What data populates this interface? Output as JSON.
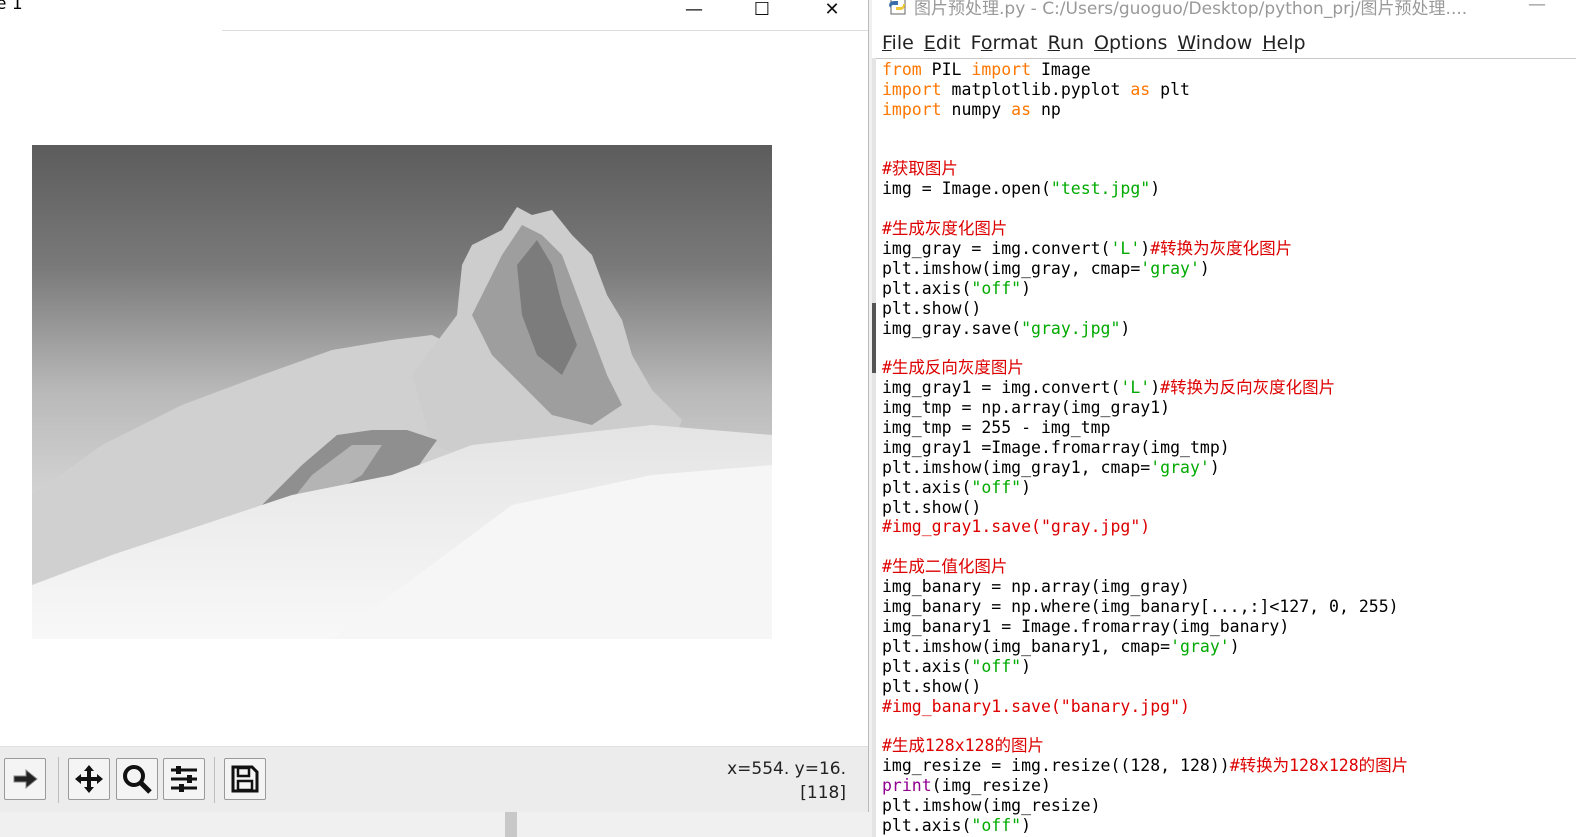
{
  "figure_window": {
    "title": "e 1",
    "controls": {
      "minimize": "—",
      "maximize": "☐",
      "close": "✕"
    },
    "toolbar": {
      "buttons": [
        "forward-icon",
        "pan-icon",
        "zoom-icon",
        "configure-subplots-icon",
        "save-icon"
      ]
    },
    "coordinates": "x=554. y=16.",
    "pixel_value": "[118]"
  },
  "idle": {
    "title": "图片预处理.py - C:/Users/guoguo/Desktop/python_prj/图片预处理....",
    "minimize": "—",
    "menu": [
      {
        "pre": "",
        "u": "F",
        "post": "ile"
      },
      {
        "pre": "",
        "u": "E",
        "post": "dit"
      },
      {
        "pre": "F",
        "u": "o",
        "post": "rmat"
      },
      {
        "pre": "",
        "u": "R",
        "post": "un"
      },
      {
        "pre": "",
        "u": "O",
        "post": "ptions"
      },
      {
        "pre": "",
        "u": "W",
        "post": "indow"
      },
      {
        "pre": "",
        "u": "H",
        "post": "elp"
      }
    ],
    "code_lines": [
      [
        [
          "kw",
          "from"
        ],
        [
          "n",
          " PIL "
        ],
        [
          "kw",
          "import"
        ],
        [
          "n",
          " Image"
        ]
      ],
      [
        [
          "kw",
          "import"
        ],
        [
          "n",
          " matplotlib.pyplot "
        ],
        [
          "kw",
          "as"
        ],
        [
          "n",
          " plt"
        ]
      ],
      [
        [
          "kw",
          "import"
        ],
        [
          "n",
          " numpy "
        ],
        [
          "kw",
          "as"
        ],
        [
          "n",
          " np"
        ]
      ],
      [],
      [],
      [
        [
          "cm",
          "#获取图片"
        ]
      ],
      [
        [
          "n",
          "img = Image.open("
        ],
        [
          "st",
          "\"test.jpg\""
        ],
        [
          "n",
          ")"
        ]
      ],
      [],
      [
        [
          "cm",
          "#生成灰度化图片"
        ]
      ],
      [
        [
          "n",
          "img_gray = img.convert("
        ],
        [
          "st",
          "'L'"
        ],
        [
          "n",
          ")"
        ],
        [
          "cm",
          "#转换为灰度化图片"
        ]
      ],
      [
        [
          "n",
          "plt.imshow(img_gray, cmap="
        ],
        [
          "st",
          "'gray'"
        ],
        [
          "n",
          ")"
        ]
      ],
      [
        [
          "n",
          "plt.axis("
        ],
        [
          "st",
          "\"off\""
        ],
        [
          "n",
          ")"
        ]
      ],
      [
        [
          "n",
          "plt.show()"
        ]
      ],
      [
        [
          "n",
          "img_gray.save("
        ],
        [
          "st",
          "\"gray.jpg\""
        ],
        [
          "n",
          ")"
        ]
      ],
      [],
      [
        [
          "cm",
          "#生成反向灰度图片"
        ]
      ],
      [
        [
          "n",
          "img_gray1 = img.convert("
        ],
        [
          "st",
          "'L'"
        ],
        [
          "n",
          ")"
        ],
        [
          "cm",
          "#转换为反向灰度化图片"
        ]
      ],
      [
        [
          "n",
          "img_tmp = np.array(img_gray1)"
        ]
      ],
      [
        [
          "n",
          "img_tmp = 255 - img_tmp"
        ]
      ],
      [
        [
          "n",
          "img_gray1 =Image.fromarray(img_tmp)"
        ]
      ],
      [
        [
          "n",
          "plt.imshow(img_gray1, cmap="
        ],
        [
          "st",
          "'gray'"
        ],
        [
          "n",
          ")"
        ]
      ],
      [
        [
          "n",
          "plt.axis("
        ],
        [
          "st",
          "\"off\""
        ],
        [
          "n",
          ")"
        ]
      ],
      [
        [
          "n",
          "plt.show()"
        ]
      ],
      [
        [
          "cm",
          "#img_gray1.save(\"gray.jpg\")"
        ]
      ],
      [],
      [
        [
          "cm",
          "#生成二值化图片"
        ]
      ],
      [
        [
          "n",
          "img_banary = np.array(img_gray)"
        ]
      ],
      [
        [
          "n",
          "img_banary = np.where(img_banary[...,:]<127, 0, 255)"
        ]
      ],
      [
        [
          "n",
          "img_banary1 = Image.fromarray(img_banary)"
        ]
      ],
      [
        [
          "n",
          "plt.imshow(img_banary1, cmap="
        ],
        [
          "st",
          "'gray'"
        ],
        [
          "n",
          ")"
        ]
      ],
      [
        [
          "n",
          "plt.axis("
        ],
        [
          "st",
          "\"off\""
        ],
        [
          "n",
          ")"
        ]
      ],
      [
        [
          "n",
          "plt.show()"
        ]
      ],
      [
        [
          "cm",
          "#img_banary1.save(\"banary.jpg\")"
        ]
      ],
      [],
      [
        [
          "cm",
          "#生成128x128的图片"
        ]
      ],
      [
        [
          "n",
          "img_resize = img.resize((128, 128))"
        ],
        [
          "cm",
          "#转换为128x128的图片"
        ]
      ],
      [
        [
          "bi",
          "print"
        ],
        [
          "n",
          "(img_resize)"
        ]
      ],
      [
        [
          "n",
          "plt.imshow(img_resize)"
        ]
      ],
      [
        [
          "n",
          "plt.axis("
        ],
        [
          "st",
          "\"off\""
        ],
        [
          "n",
          ")"
        ]
      ]
    ]
  }
}
